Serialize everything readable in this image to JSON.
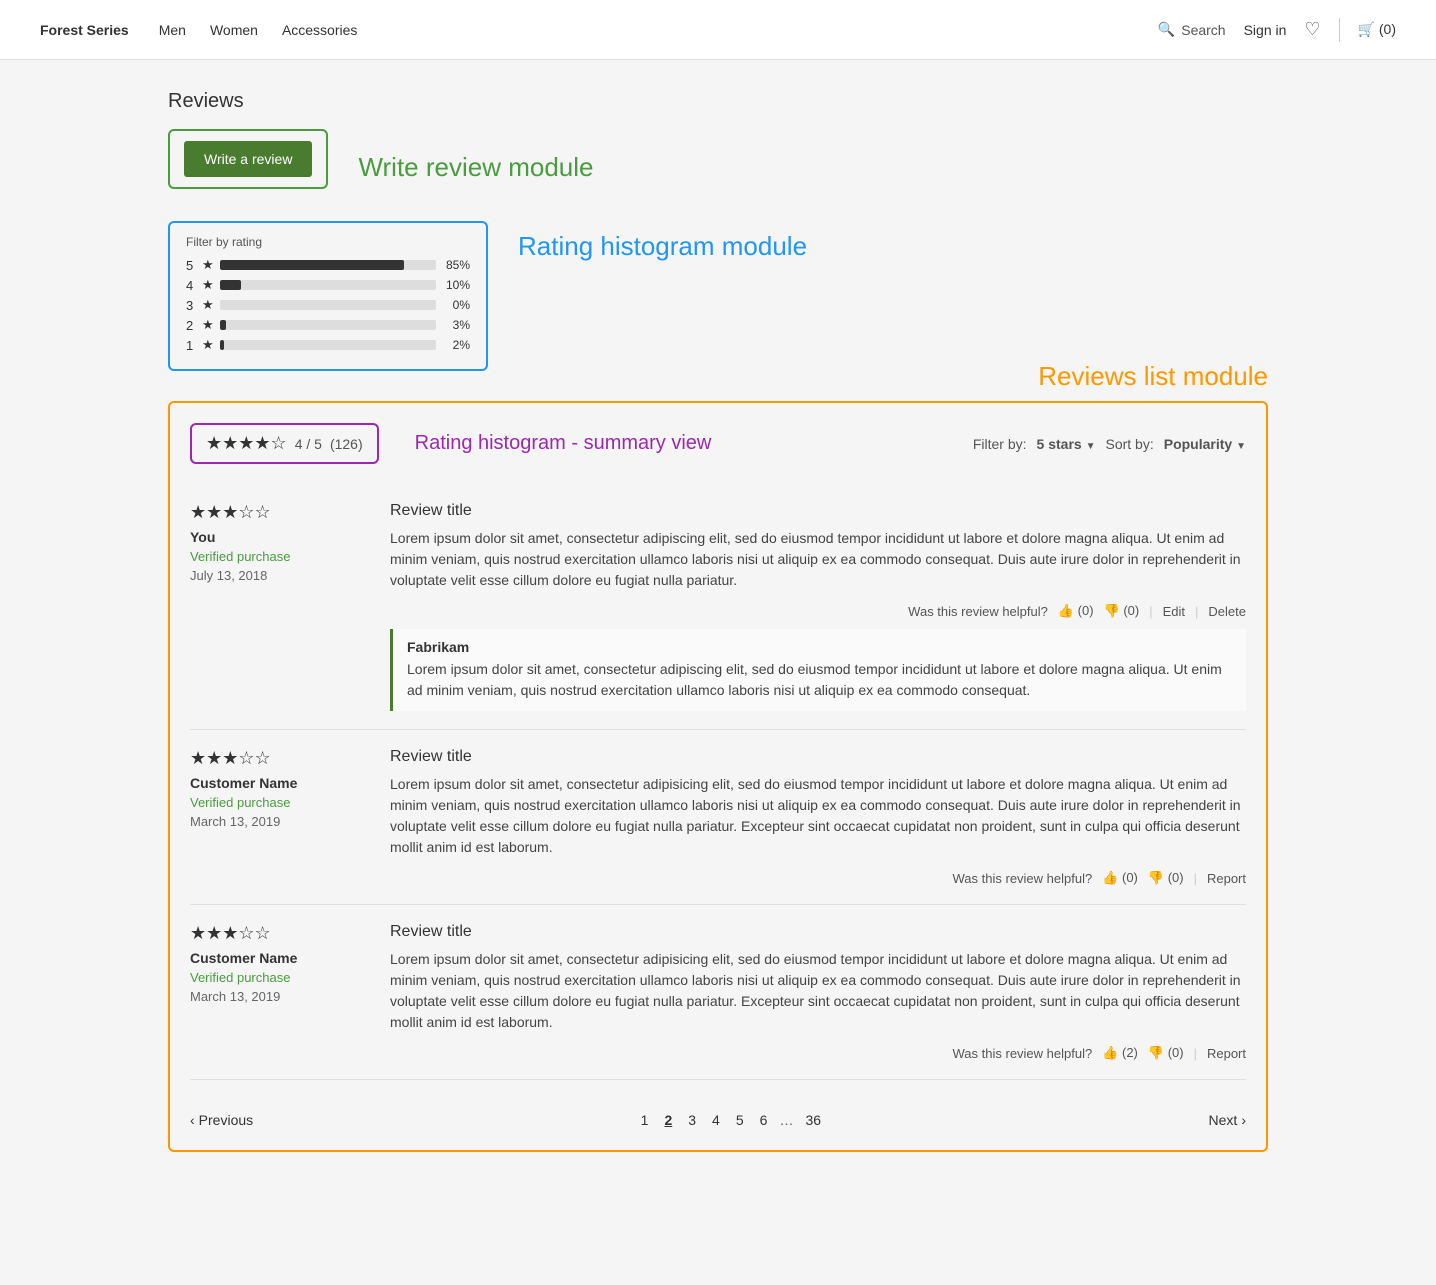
{
  "nav": {
    "brand": "Forest Series",
    "links": [
      "Men",
      "Women",
      "Accessories"
    ],
    "search_label": "Search",
    "signin_label": "Sign in",
    "cart_label": "(0)"
  },
  "page": {
    "reviews_heading": "Reviews",
    "write_review_btn": "Write a review",
    "module_label_write": "Write review module",
    "module_label_histogram": "Rating histogram module",
    "module_label_reviews_list": "Reviews list module",
    "module_label_summary": "Rating histogram - summary view"
  },
  "histogram": {
    "title": "Filter by rating",
    "rows": [
      {
        "star": "5",
        "pct": 85,
        "label": "85%"
      },
      {
        "star": "4",
        "pct": 10,
        "label": "10%"
      },
      {
        "star": "3",
        "pct": 0,
        "label": "0%"
      },
      {
        "star": "2",
        "pct": 3,
        "label": "3%"
      },
      {
        "star": "1",
        "pct": 2,
        "label": "2%"
      }
    ]
  },
  "summary": {
    "stars_filled": 4,
    "stars_empty": 1,
    "score": "4 / 5",
    "count": "(126)",
    "filter_label": "Filter by:",
    "filter_value": "5 stars",
    "sort_label": "Sort by:",
    "sort_value": "Popularity"
  },
  "reviews": [
    {
      "stars_filled": 3,
      "stars_empty": 2,
      "author": "You",
      "verified": "Verified purchase",
      "date": "July 13, 2018",
      "title": "Review title",
      "body": "Lorem ipsum dolor sit amet, consectetur adipiscing elit, sed do eiusmod tempor incididunt ut labore et dolore magna aliqua. Ut enim ad minim veniam, quis nostrud exercitation ullamco laboris nisi ut aliquip ex ea commodo consequat. Duis aute irure dolor in reprehenderit in voluptate velit esse cillum dolore eu fugiat nulla pariatur.",
      "helpful_up": "0",
      "helpful_down": "0",
      "has_actions_edit_delete": true,
      "vendor_response": {
        "name": "Fabrikam",
        "text": "Lorem ipsum dolor sit amet, consectetur adipiscing elit, sed do eiusmod tempor incididunt ut labore et dolore magna aliqua. Ut enim ad minim veniam, quis nostrud exercitation ullamco laboris nisi ut aliquip ex ea commodo consequat."
      }
    },
    {
      "stars_filled": 3,
      "stars_empty": 2,
      "author": "Customer Name",
      "verified": "Verified purchase",
      "date": "March 13, 2019",
      "title": "Review title",
      "body": "Lorem ipsum dolor sit amet, consectetur adipisicing elit, sed do eiusmod tempor incididunt ut labore et dolore magna aliqua. Ut enim ad minim veniam, quis nostrud exercitation ullamco laboris nisi ut aliquip ex ea commodo consequat. Duis aute irure dolor in reprehenderit in voluptate velit esse cillum dolore eu fugiat nulla pariatur. Excepteur sint occaecat cupidatat non proident, sunt in culpa qui officia deserunt mollit anim id est laborum.",
      "helpful_up": "0",
      "helpful_down": "0",
      "has_actions_edit_delete": false,
      "vendor_response": null
    },
    {
      "stars_filled": 3,
      "stars_empty": 2,
      "author": "Customer Name",
      "verified": "Verified purchase",
      "date": "March 13, 2019",
      "title": "Review title",
      "body": "Lorem ipsum dolor sit amet, consectetur adipisicing elit, sed do eiusmod tempor incididunt ut labore et dolore magna aliqua. Ut enim ad minim veniam, quis nostrud exercitation ullamco laboris nisi ut aliquip ex ea commodo consequat. Duis aute irure dolor in reprehenderit in voluptate velit esse cillum dolore eu fugiat nulla pariatur. Excepteur sint occaecat cupidatat non proident, sunt in culpa qui officia deserunt mollit anim id est laborum.",
      "helpful_up": "2",
      "helpful_down": "0",
      "has_actions_edit_delete": false,
      "vendor_response": null
    }
  ],
  "pagination": {
    "prev_label": "Previous",
    "next_label": "Next",
    "pages": [
      "1",
      "2",
      "3",
      "4",
      "5",
      "6",
      "...",
      "36"
    ],
    "active_page": "2"
  }
}
